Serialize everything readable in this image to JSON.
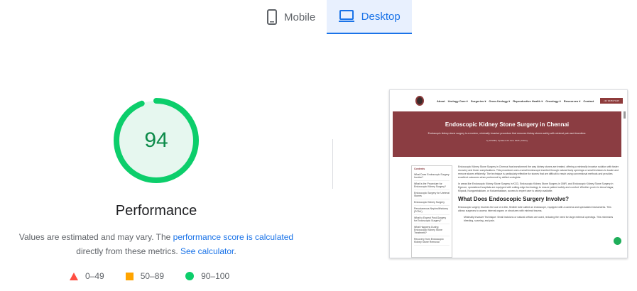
{
  "tabs": [
    {
      "label": "Mobile",
      "icon": "mobile-icon",
      "active": false
    },
    {
      "label": "Desktop",
      "icon": "desktop-icon",
      "active": true
    }
  ],
  "gauge": {
    "score": "94",
    "fraction": 0.94,
    "color": "#0cce6b",
    "fill": "#e6f7ef"
  },
  "performance": {
    "title": "Performance",
    "note_prefix": "Values are estimated and may vary. The ",
    "note_link1": "performance score is calculated",
    "note_middle": "directly from these metrics. ",
    "note_link2": "See calculator",
    "note_suffix": "."
  },
  "legend": [
    {
      "range": "0–49",
      "shape": "triangle",
      "color": "#ff4e42"
    },
    {
      "range": "50–89",
      "shape": "square",
      "color": "#ffa400"
    },
    {
      "range": "90–100",
      "shape": "circle",
      "color": "#0cce6b"
    }
  ],
  "screenshot": {
    "menu": [
      "About",
      "Urology Care ▾",
      "Surgeries ▾",
      "Onco-Urology ▾",
      "Reproductive Health ▾",
      "Oncology ▾",
      "Resources ▾",
      "Contact"
    ],
    "cta": "+91 9445371115",
    "hero_title": "Endoscopic Kidney Stone Surgery in Chennai",
    "hero_sub": "Endoscopic kidney stone surgery is a modern, minimally invasive procedure that removes kidney stones safely with minimal pain and downtime.",
    "hero_meta": "by DrSMR   |   Updated 20 June 2025   |   Kidney",
    "sidebar_head": "Contents",
    "sidebar_items": [
      "What Does Endoscopic Surgery Involve?",
      "What is the Procedure for Endoscopic Kidney Surgery?",
      "Endoscopic Surgery for Ureteral Stones",
      "Endoscopic Kidney Surgery",
      "Percutaneous Nephrolithotomy (PCNL)",
      "What to Expect Post-Surgery for Endoscopic Surgery?",
      "What Happens During Endoscopic Kidney Stone Treatment?",
      "Recovery from Endoscopic Kidney Stone Removal"
    ],
    "para1": "Endoscopic Kidney Stone Surgery in Chennai has transformed the way kidney stones are treated, offering a minimally invasive solution with faster recovery and fewer complications. This procedure uses a small endoscope inserted through natural body openings or small incisions to locate and remove stones efficiently. The technique is particularly effective for stones that are difficult to reach using conventional methods and provides excellent outcomes when performed by skilled urologists.",
    "para2": "In areas like Endoscopic Kidney Stone Surgery in KCD, Endoscopic Kidney Stone Surgery in OMR, and Endoscopic Kidney Stone Surgery in Egmore, specialized hospitals are equipped with cutting-edge technology to ensure patient safety and comfort. Whether you're in Anna Nagar, Kilpauk, Nungambakkam, or Kodambakkam, access to expert care is widely available.",
    "h2": "What Does Endoscopic Surgery Involve?",
    "para3": "Endoscopic surgery involves the use of a thin, flexible tube called an endoscope, equipped with a camera and specialized instruments. This allows surgeons to access internal organs or structures with minimal trauma.",
    "bullet": "Minimally Invasive Technique: Small incisions or natural orifices are used, reducing the need for large external openings. This minimizes bleeding, scarring, and pain."
  }
}
